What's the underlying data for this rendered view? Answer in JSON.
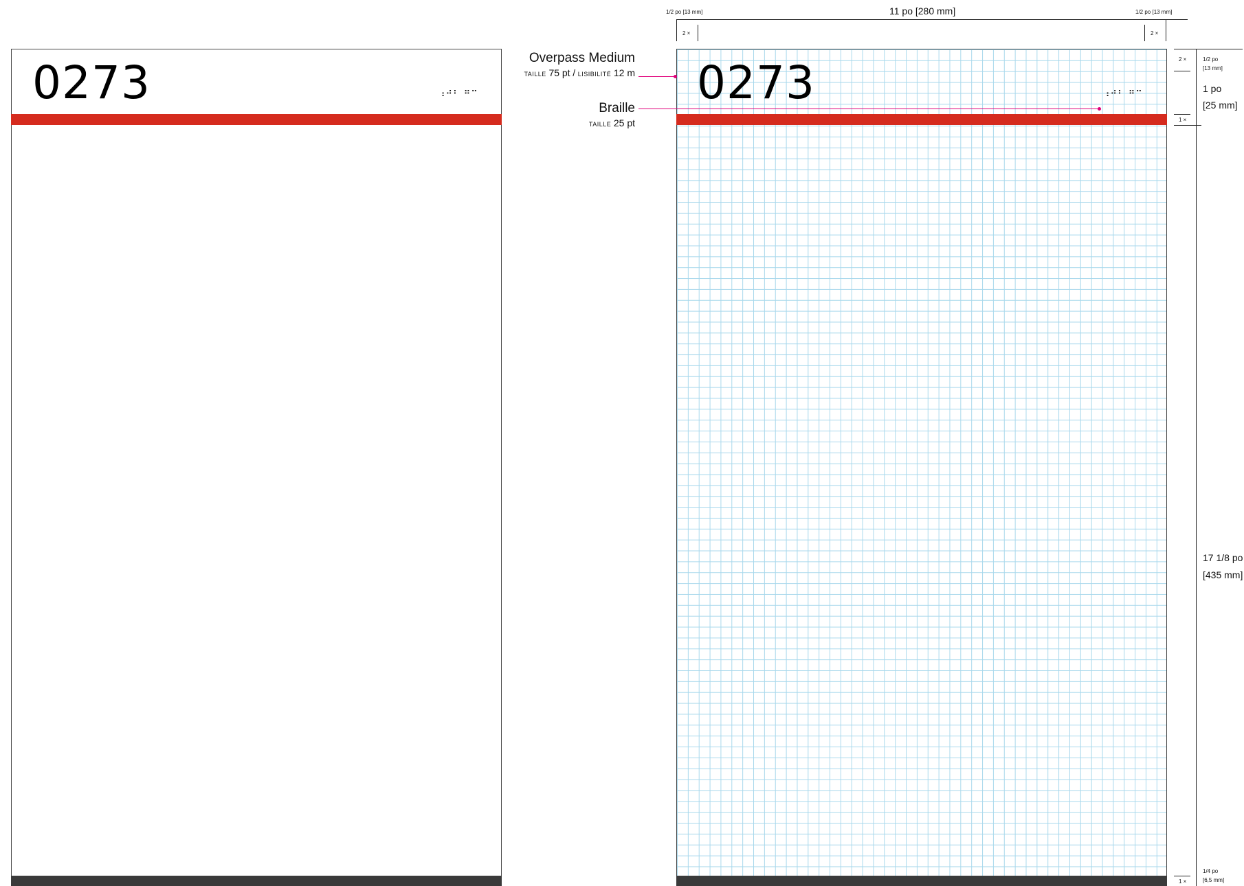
{
  "sign": {
    "number": "0273",
    "braille": "⠰⠚⠃ ⠛⠉"
  },
  "colors": {
    "accent_red": "#d52b1e",
    "footer_dark": "#3a3a3a",
    "grid_blue": "#a8d8ec",
    "annotation_pink": "#e0007a"
  },
  "annotations": {
    "font": {
      "title": "Overpass Medium",
      "size_label": "TAILLE",
      "size_value": "75 pt",
      "separator": "/",
      "legibility_label": "LISIBILITÉ",
      "legibility_value": "12 m"
    },
    "braille": {
      "title": "Braille",
      "size_label": "TAILLE",
      "size_value": "25 pt"
    }
  },
  "dimensions": {
    "top": {
      "total": "11 po [280 mm]",
      "margin_left": "1/2 po [13 mm]",
      "margin_right": "1/2 po [13 mm]",
      "mult_left": "2 ×",
      "mult_right": "2 ×"
    },
    "right": {
      "top_margin_line1": "1/2 po",
      "top_margin_line2": "[13 mm]",
      "top_mult": "2 ×",
      "header_line1": "1 po",
      "header_line2": "[25 mm]",
      "band_mult": "1 ×",
      "body_line1": "17 1/8 po",
      "body_line2": "[435 mm]",
      "bottom_line1": "1/4 po",
      "bottom_line2": "[6,5 mm]",
      "bottom_mult": "1 ×"
    }
  }
}
